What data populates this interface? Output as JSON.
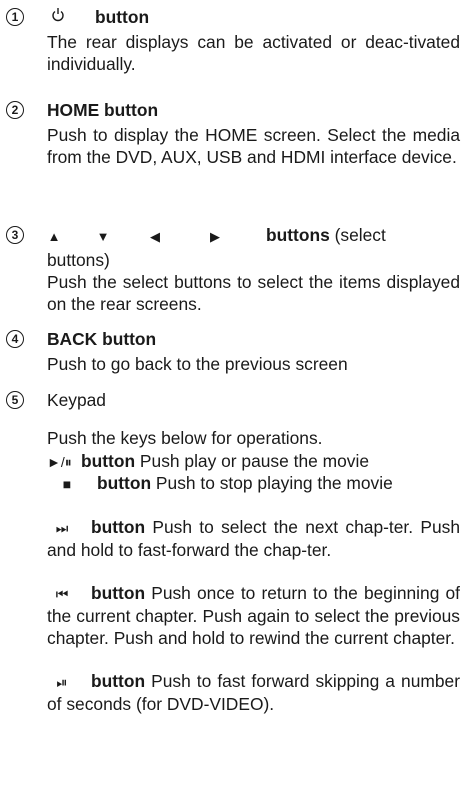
{
  "items": [
    {
      "num": "1",
      "icon": "power-icon",
      "label": "button",
      "text": "The rear displays can be activated or deac-tivated individually."
    },
    {
      "num": "2",
      "label": "HOME button",
      "text": "Push to display the HOME screen. Select the media from the DVD, AUX, USB and HDMI interface device."
    },
    {
      "num": "3",
      "label": "buttons",
      "suffix": "(select",
      "cont": "buttons)",
      "text": "Push the select buttons to select the items displayed on the rear screens."
    },
    {
      "num": "4",
      "label": "BACK button",
      "text": "Push to go back to the previous screen"
    },
    {
      "num": "5",
      "label": "Keypad",
      "intro": "Push the keys below for operations."
    }
  ],
  "keys": [
    {
      "icon": "play-pause-icon",
      "glyph": "►/⏸",
      "label": "button",
      "text": "Push play or pause the movie"
    },
    {
      "icon": "stop-icon",
      "glyph": "■",
      "label": "button",
      "text": "Push to stop playing the movie"
    },
    {
      "icon": "next-chapter-icon",
      "glyph": "⏭",
      "label": "button",
      "text": "Push to select the next chap-ter. Push and hold to fast-forward the chap-ter."
    },
    {
      "icon": "previous-chapter-icon",
      "glyph": "⏮",
      "label": "button",
      "text": "Push once to return to the beginning of the current chapter. Push again to select the previous chapter. Push and hold to rewind the current chapter."
    },
    {
      "icon": "skip-forward-icon",
      "glyph": "⏯",
      "label": "button",
      "text": "Push to fast forward skipping a number of seconds (for DVD-VIDEO)."
    }
  ]
}
